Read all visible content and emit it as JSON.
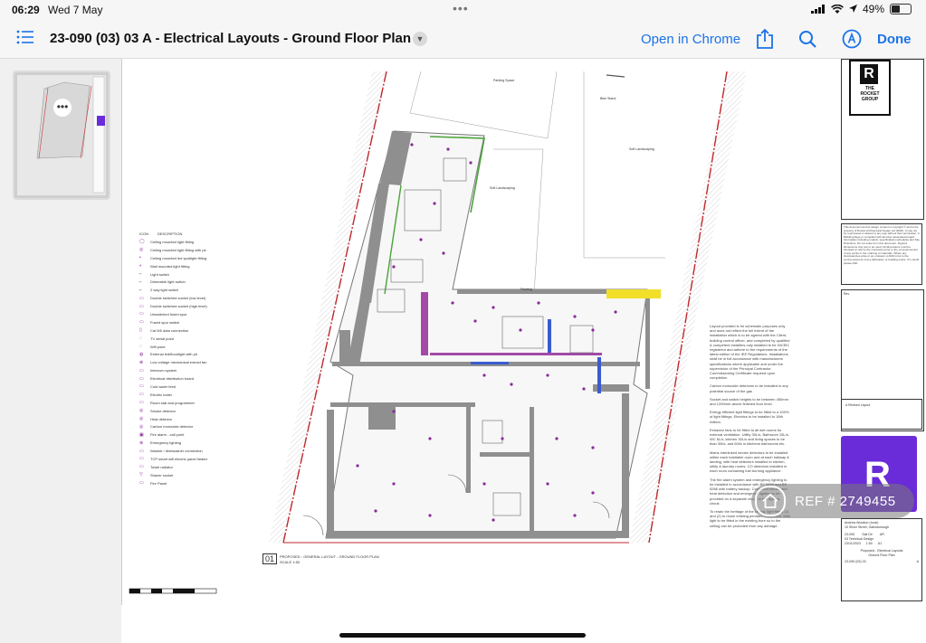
{
  "status_bar": {
    "time": "06:29",
    "date": "Wed 7 May",
    "battery": "49%",
    "battery_level": 0.49
  },
  "toolbar": {
    "title": "23-090 (03) 03 A - Electrical Layouts - Ground Floor Plan",
    "open_in_chrome": "Open in Chrome",
    "done": "Done",
    "accent_color": "#1a73e8"
  },
  "drawing": {
    "legend_header": {
      "icon": "ICON",
      "description": "DESCRIPTION"
    },
    "legend": [
      "Ceiling mounted light fitting",
      "Ceiling mounted light fitting with pir",
      "Ceiling mounted led spotlight fitting",
      "Wall mounted light fitting",
      "Light switch",
      "Dimmable light switch",
      "2 way light switch",
      "Double switched socket (low level)",
      "Double switched socket (high level)",
      "Unswitched fused spur",
      "Fused spur switch",
      "Cat 6/6 data connection",
      "TV aerial point",
      "Wifi point",
      "External led/floodlight with pir",
      "Low voltage mechanical extract fan",
      "Intercom system",
      "Electrical distribution board",
      "Cold water feed",
      "Electric boiler",
      "Room stat and programmer",
      "Smoke detector",
      "Heat detector",
      "Carbon monoxide detector",
      "Fire alarm - call point",
      "Emergency lighting",
      "Washer / dishwasher connection",
      "TCP smart wifi electric panel heater",
      "Towel radiator",
      "Shaver socket",
      "Fire Panel"
    ],
    "area_labels": {
      "parking": "Parking Space",
      "bike": "Bike Stand",
      "soft1": "Soft Landscaping",
      "soft2": "Soft Landscaping",
      "planting": "Planting"
    },
    "drawing_number": "01",
    "drawing_caption": "PROPOSED - GENERAL LAYOUT - GROUND FLOOR PLAN",
    "scale": "SCALE 1:50",
    "notes": [
      "Layout provided is for schematic purposes only and does not reflect the full extent of the installation which is to be agreed with the Client, building control officer, and completed by qualified & competent installers only installed to be NICEIC registered and adhere to the requirements of the latest edition of the IEE Regulations. Installations shall be in full accordance with manufacturers specifications where applicable and under the supervision of the Principal Contractor. Commissioning Certificate required upon completion",
      "Carbon monoxide detectors to be installed in any potential source of the gas",
      "Socket and switch heights to be between 450mm and 1200mm above finished floor level.",
      "Energy efficient light fittings to be fitted to a 100% of light fittings. Electrics to be installed to 18th edition.",
      "Extractor fans to be fitted to all wet rooms for external ventilation. Utility 30L/s, Bathroom 15L/s, WC 6L/s, kitchen 30L/s and living spaces to be than 30l/s, and 60l/s in kitchens bathrooms etc.",
      "Mains interlinked smoke detectors to be installed within each habitable room and at each hallway & landing, with heat detectors installed in kitchen, utility & laundry rooms. CO detectors installed in each room containing fuel burning appliance.",
      "The fire alarm system and emergency lighting to be installed in accordance with BS 5839 and BS 5266 with battery backup. Combined smoke and heat detection and emergency lighting to be provided on a separate circuit to the lighting circuit.",
      "To retain the heritage of the ceiling, light fitting (1) and (2) to reuse existing pendant connection. Wall light to be fitted in the existing bore so to the ceiling can be protected from any damage."
    ],
    "title_block": {
      "brand_line1": "THE",
      "brand_line2": "ROCKET",
      "brand_line3": "GROUP",
      "disclaimer": "This document and its design content is copyright © and is the property of Rocket Architectural Design Ltd (RAD). It may not be reproduced or altered in any way without their permission. A Building Regs or compliant with all other associated project information including models, specifications schedules and Site Directions. Do not scale from this document. Figured dimensions only are to be used. All dimensions must be checked on site by the Contractor prior to the commencement of any works or the ordering of materials. Where any discrepancies arise or an omission to RAD prior to the commencement of any fabrication or building works. If in doubt please ASK",
      "revisions_header": "Rev",
      "revision_text": "A  Revised Layout",
      "client": "Andrew Wootton (Ionic)",
      "address": "10 Silver Street, Gainsborough",
      "fields": [
        "23-090",
        "Sail Dir",
        "AR"
      ],
      "stage": "03 Technical Design",
      "fields2": [
        "23/11/2023",
        "1:50",
        "A1"
      ],
      "drawing_title_line1": "Proposed - Electrical Layouts",
      "drawing_title_line2": "Ground Floor Plan",
      "drawing_ref": "23-090 (03) 03",
      "revision": "A",
      "brand_color": "#6a2bd8"
    }
  },
  "watermark": {
    "text": "REF # 2749455"
  }
}
